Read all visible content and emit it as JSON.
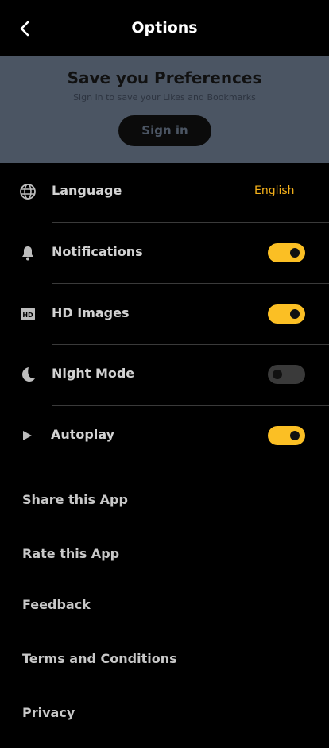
{
  "header": {
    "title": "Options",
    "back_icon": "chevron-left-icon"
  },
  "banner": {
    "title": "Save you Preferences",
    "subtitle": "Sign in to save your Likes and Bookmarks",
    "signin_label": "Sign in"
  },
  "settings": [
    {
      "label": "Language",
      "icon": "globe-icon",
      "value": "English"
    },
    {
      "label": "Notifications",
      "icon": "bell-icon",
      "enabled": true
    },
    {
      "label": "HD Images",
      "icon": "hd-icon",
      "enabled": true
    },
    {
      "label": "Night Mode",
      "icon": "moon-icon",
      "enabled": false
    },
    {
      "label": "Autoplay",
      "icon": "play-icon",
      "enabled": true
    }
  ],
  "links": [
    "Share this App",
    "Rate this App",
    "Feedback",
    "Terms and Conditions",
    "Privacy"
  ],
  "colors": {
    "accent": "#fbbf24",
    "banner_bg": "#4b5563",
    "background": "#000000"
  }
}
